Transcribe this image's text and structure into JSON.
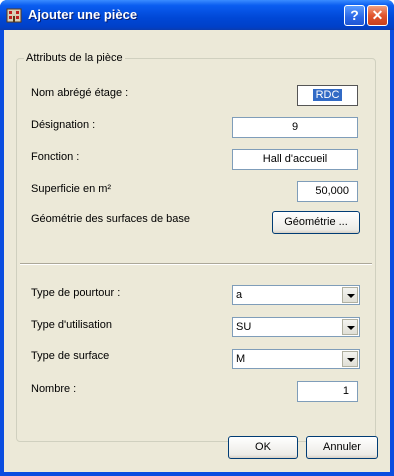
{
  "window": {
    "title": "Ajouter une pièce",
    "help_label": "?",
    "close_label": "✕"
  },
  "group": {
    "label": "Attributs de la pièce"
  },
  "fields": {
    "nom_label": "Nom abrégé étage :",
    "nom_value": "RDC",
    "designation_label": "Désignation :",
    "designation_value": "9",
    "fonction_label": "Fonction :",
    "fonction_value": "Hall d'accueil",
    "superficie_label": "Superficie en m²",
    "superficie_value": "50,000",
    "geometrie_label": "Géométrie des surfaces de base",
    "geometrie_button": "Géométrie ...",
    "pourtour_label": "Type de pourtour :",
    "pourtour_value": "a",
    "utilisation_label": "Type d'utilisation",
    "utilisation_value": "SU",
    "surface_label": "Type de surface",
    "surface_value": "M",
    "nombre_label": "Nombre :",
    "nombre_value": "1"
  },
  "buttons": {
    "ok": "OK",
    "cancel": "Annuler"
  }
}
